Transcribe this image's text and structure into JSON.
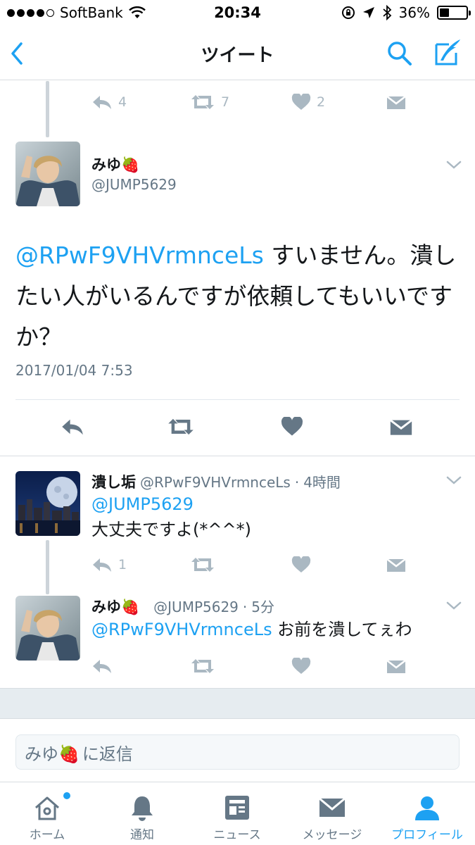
{
  "status_bar": {
    "carrier": "SoftBank",
    "time": "20:34",
    "battery": "36%",
    "battery_level": 0.36
  },
  "nav": {
    "title": "ツイート"
  },
  "parent_actions": {
    "reply_count": "4",
    "retweet_count": "7",
    "like_count": "2"
  },
  "main_tweet": {
    "name": "みゆ🍓",
    "handle": "@JUMP5629",
    "mention": "@RPwF9VHVrmnceLs",
    "text": " すいません。潰したい人がいるんですが依頼してもいいですか？",
    "timestamp": "2017/01/04 7:53"
  },
  "replies": [
    {
      "name": "潰し垢",
      "handle": "@RPwF9VHVrmnceLs",
      "time": "4時間",
      "mention": "@JUMP5629",
      "text": "大丈夫ですよ(*^^*)",
      "reply_count": "1"
    },
    {
      "name": "みゆ🍓",
      "handle": "@JUMP5629",
      "time": "5分",
      "mention": "@RPwF9VHVrmnceLs",
      "text": " お前を潰してぇわ"
    }
  ],
  "reply_box": {
    "prefix": "みゆ🍓",
    "suffix": " に返信"
  },
  "tabs": [
    {
      "label": "ホーム",
      "icon": "home-icon"
    },
    {
      "label": "通知",
      "icon": "bell-icon"
    },
    {
      "label": "ニュース",
      "icon": "news-icon"
    },
    {
      "label": "メッセージ",
      "icon": "envelope-icon"
    },
    {
      "label": "プロフィール",
      "icon": "person-icon",
      "active": true
    }
  ],
  "colors": {
    "accent": "#1da1f2",
    "icon_gray": "#aab8c2",
    "text_gray": "#657786"
  }
}
